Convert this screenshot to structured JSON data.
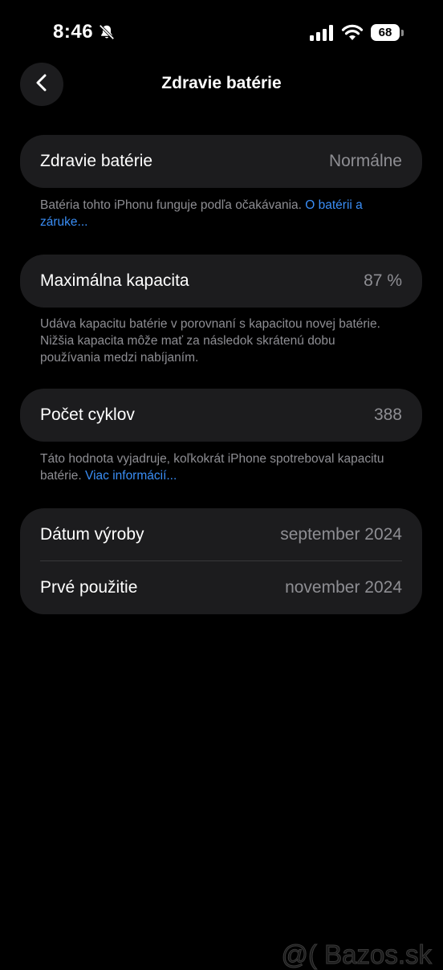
{
  "status_bar": {
    "time": "8:46",
    "battery_level": "68",
    "icons": [
      "bell-slash-icon",
      "cellular-signal-icon",
      "wifi-icon",
      "battery-icon"
    ]
  },
  "nav": {
    "title": "Zdravie batérie",
    "back_icon": "chevron-left-icon"
  },
  "health": {
    "label": "Zdravie batérie",
    "value": "Normálne",
    "footnote_text": "Batéria tohto iPhonu funguje podľa očakávania. ",
    "footnote_link": "O batérii a záruke..."
  },
  "capacity": {
    "label": "Maximálna kapacita",
    "value": "87 %",
    "footnote_text": "Udáva kapacitu batérie v porovnaní s kapacitou novej batérie. Nižšia kapacita môže mať za následok skrátenú dobu používania medzi nabíjaním."
  },
  "cycles": {
    "label": "Počet cyklov",
    "value": "388",
    "footnote_text": "Táto hodnota vyjadruje, koľkokrát iPhone spotreboval kapacitu batérie. ",
    "footnote_link": "Viac informácií..."
  },
  "dates": {
    "manufacture_label": "Dátum výroby",
    "manufacture_value": "september 2024",
    "first_use_label": "Prvé použitie",
    "first_use_value": "november 2024"
  },
  "watermark": "@( Bazos.sk",
  "colors": {
    "background": "#000000",
    "card": "#1c1c1e",
    "secondary_text": "#8e8e93",
    "link": "#3a8ef6"
  }
}
